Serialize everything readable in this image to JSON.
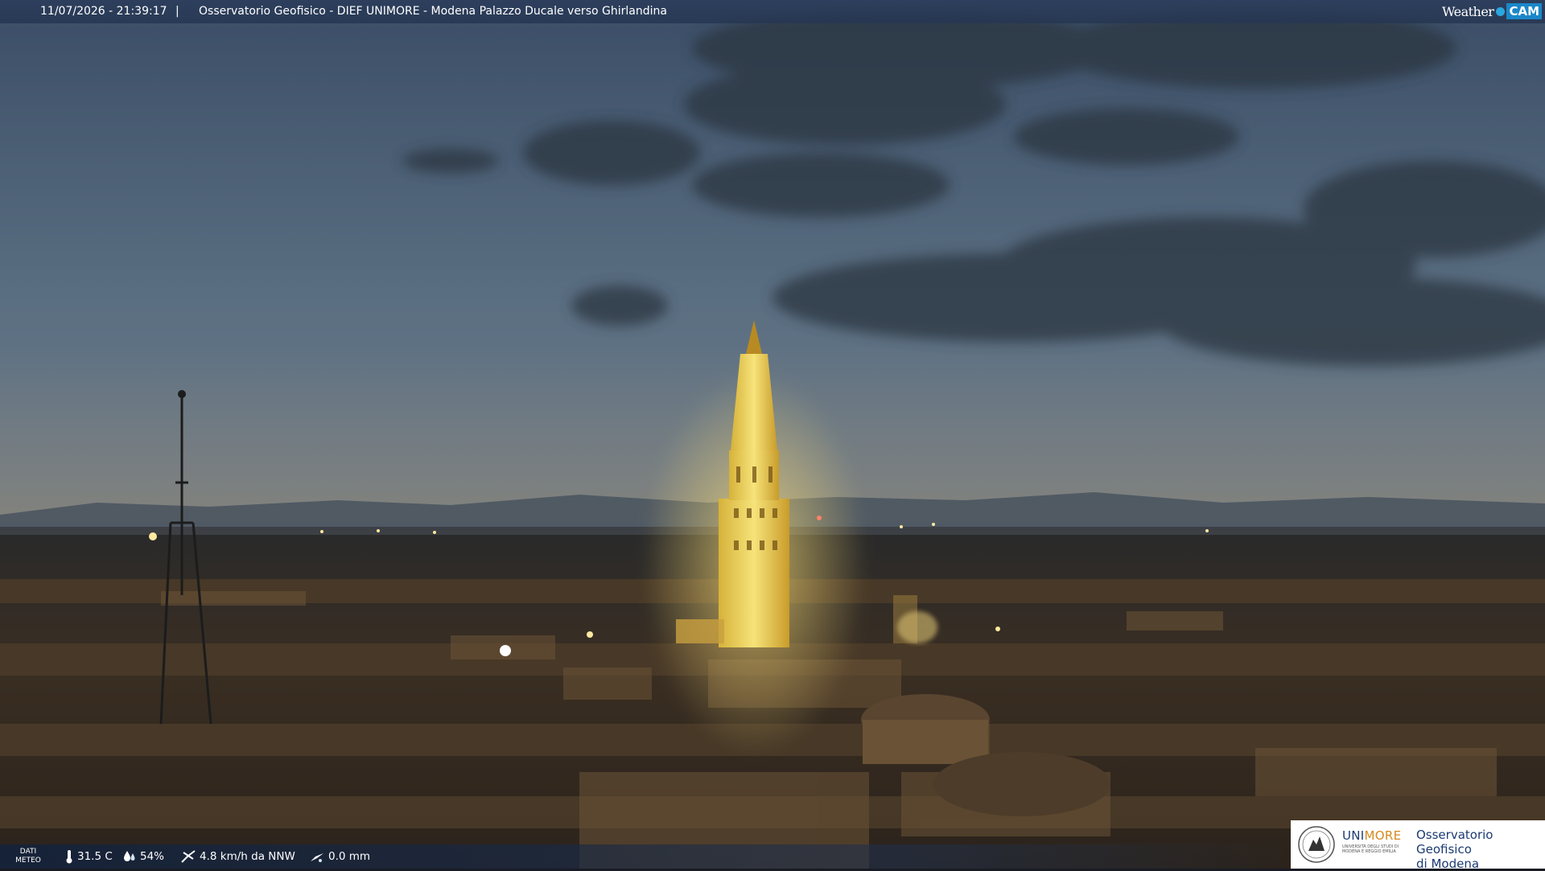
{
  "overlay": {
    "timestamp": "11/07/2026 - 21:39:17",
    "separator": "|",
    "title": "Osservatorio Geofisico - DIEF UNIMORE - Modena Palazzo Ducale verso Ghirlandina",
    "brand_weather": "Weather",
    "brand_cam": "CAM"
  },
  "weather": {
    "dati_label_1": "DATI",
    "dati_label_2": "METEO",
    "temperature": "31.5 C",
    "humidity": "54%",
    "wind": "4.8 km/h da NNW",
    "rain": "0.0 mm"
  },
  "logo": {
    "uni_part1": "UNI",
    "uni_part2": "MORE",
    "uni_subtitle": "UNIVERSITÀ DEGLI STUDI DI MODENA E REGGIO EMILIA",
    "observatory_line1": "Osservatorio Geofisico",
    "observatory_line2": "di Modena"
  },
  "colors": {
    "bar_blue": "#2c3e5c",
    "brand_cyan": "#1b87c9",
    "unimore_blue": "#1c3b72",
    "unimore_orange": "#d48a1e",
    "tower_glow": "#f3d35a"
  },
  "icons": [
    "thermometer-icon",
    "humidity-icon",
    "wind-icon",
    "rain-icon",
    "unimore-seal-icon"
  ]
}
